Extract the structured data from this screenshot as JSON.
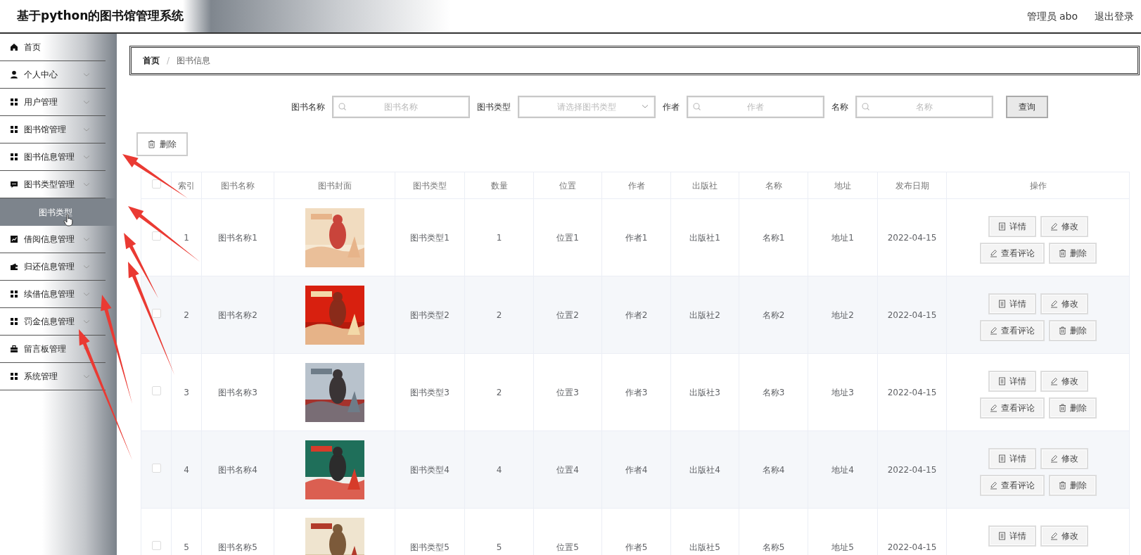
{
  "header": {
    "title": "基于python的图书馆管理系统",
    "user": "管理员 abo",
    "logout": "退出登录"
  },
  "sidebar": {
    "items": [
      {
        "label": "首页",
        "kind": "link"
      },
      {
        "label": "个人中心",
        "kind": "menu"
      },
      {
        "label": "用户管理",
        "kind": "menu"
      },
      {
        "label": "图书馆管理",
        "kind": "menu"
      },
      {
        "label": "图书信息管理",
        "kind": "menu"
      },
      {
        "label": "图书类型管理",
        "kind": "menu",
        "expanded": true,
        "children": [
          {
            "label": "图书类型",
            "selected": true
          }
        ]
      },
      {
        "label": "借阅信息管理",
        "kind": "menu"
      },
      {
        "label": "归还信息管理",
        "kind": "menu"
      },
      {
        "label": "续借信息管理",
        "kind": "menu"
      },
      {
        "label": "罚金信息管理",
        "kind": "menu"
      },
      {
        "label": "留言板管理",
        "kind": "menu"
      },
      {
        "label": "系统管理",
        "kind": "menu"
      }
    ]
  },
  "breadcrumb": {
    "separator": "/",
    "items": [
      {
        "label": "首页",
        "current": false
      },
      {
        "label": "图书信息",
        "current": true
      }
    ]
  },
  "search": {
    "fields": [
      {
        "label": "图书名称",
        "placeholder": "图书名称",
        "kind": "text"
      },
      {
        "label": "图书类型",
        "placeholder": "请选择图书类型",
        "kind": "select"
      },
      {
        "label": "作者",
        "placeholder": "作者",
        "kind": "text"
      },
      {
        "label": "名称",
        "placeholder": "名称",
        "kind": "text"
      }
    ],
    "button": "查询"
  },
  "delete_button": "删除",
  "table": {
    "select_all_checked": false,
    "columns": [
      "索引",
      "图书名称",
      "图书封面",
      "图书类型",
      "数量",
      "位置",
      "作者",
      "出版社",
      "名称",
      "地址",
      "发布日期",
      "操作"
    ],
    "rows": [
      {
        "checked": false,
        "cells": [
          "1",
          "图书名称1",
          null,
          "图书类型1",
          "1",
          "位置1",
          "作者1",
          "出版社1",
          "名称1",
          "地址1",
          "2022-04-15"
        ],
        "actions": [
          "详情",
          "修改",
          "查看评论",
          "删除"
        ]
      },
      {
        "checked": false,
        "cells": [
          "2",
          "图书名称2",
          null,
          "图书类型2",
          "2",
          "位置2",
          "作者2",
          "出版社2",
          "名称2",
          "地址2",
          "2022-04-15"
        ],
        "actions": [
          "详情",
          "修改",
          "查看评论",
          "删除"
        ]
      },
      {
        "checked": false,
        "cells": [
          "3",
          "图书名称3",
          null,
          "图书类型3",
          "2",
          "位置3",
          "作者3",
          "出版社3",
          "名称3",
          "地址3",
          "2022-04-15"
        ],
        "actions": [
          "详情",
          "修改",
          "查看评论",
          "删除"
        ]
      },
      {
        "checked": false,
        "cells": [
          "4",
          "图书名称4",
          null,
          "图书类型4",
          "4",
          "位置4",
          "作者4",
          "出版社4",
          "名称4",
          "地址4",
          "2022-04-15"
        ],
        "actions": [
          "详情",
          "修改",
          "查看评论",
          "删除"
        ]
      },
      {
        "checked": false,
        "cells": [
          "5",
          "图书名称5",
          null,
          "图书类型5",
          "5",
          "位置5",
          "作者5",
          "出版社5",
          "名称5",
          "地址5",
          "2022-04-15"
        ],
        "actions": [
          "详情",
          "修改"
        ]
      }
    ]
  }
}
